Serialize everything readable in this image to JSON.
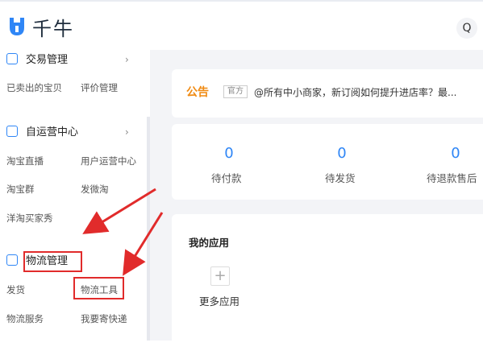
{
  "header": {
    "logo_text": "千牛",
    "search_icon": "Q"
  },
  "sidebar": {
    "groups": [
      {
        "title": "交易管理",
        "icon": "calendar-icon",
        "items": [
          "已卖出的宝贝",
          "评价管理"
        ]
      },
      {
        "title": "自运营中心",
        "icon": "chat-icon",
        "items": [
          "淘宝直播",
          "用户运营中心",
          "淘宝群",
          "发微淘",
          "洋淘买家秀"
        ]
      },
      {
        "title": "物流管理",
        "icon": "logistics-icon",
        "items": [
          "发货",
          "物流工具",
          "物流服务",
          "我要寄快递"
        ]
      }
    ],
    "chevron": "›"
  },
  "notice": {
    "label": "公告",
    "tag": "官方",
    "text": "@所有中小商家，新订阅如何提升进店率？最..."
  },
  "stats": [
    {
      "value": "0",
      "label": "待付款"
    },
    {
      "value": "0",
      "label": "待发货"
    },
    {
      "value": "0",
      "label": "待退款售后"
    }
  ],
  "apps": {
    "title": "我的应用",
    "add_symbol": "+",
    "more_label": "更多应用"
  },
  "annotations": {
    "highlight_color": "#e12b2b"
  }
}
